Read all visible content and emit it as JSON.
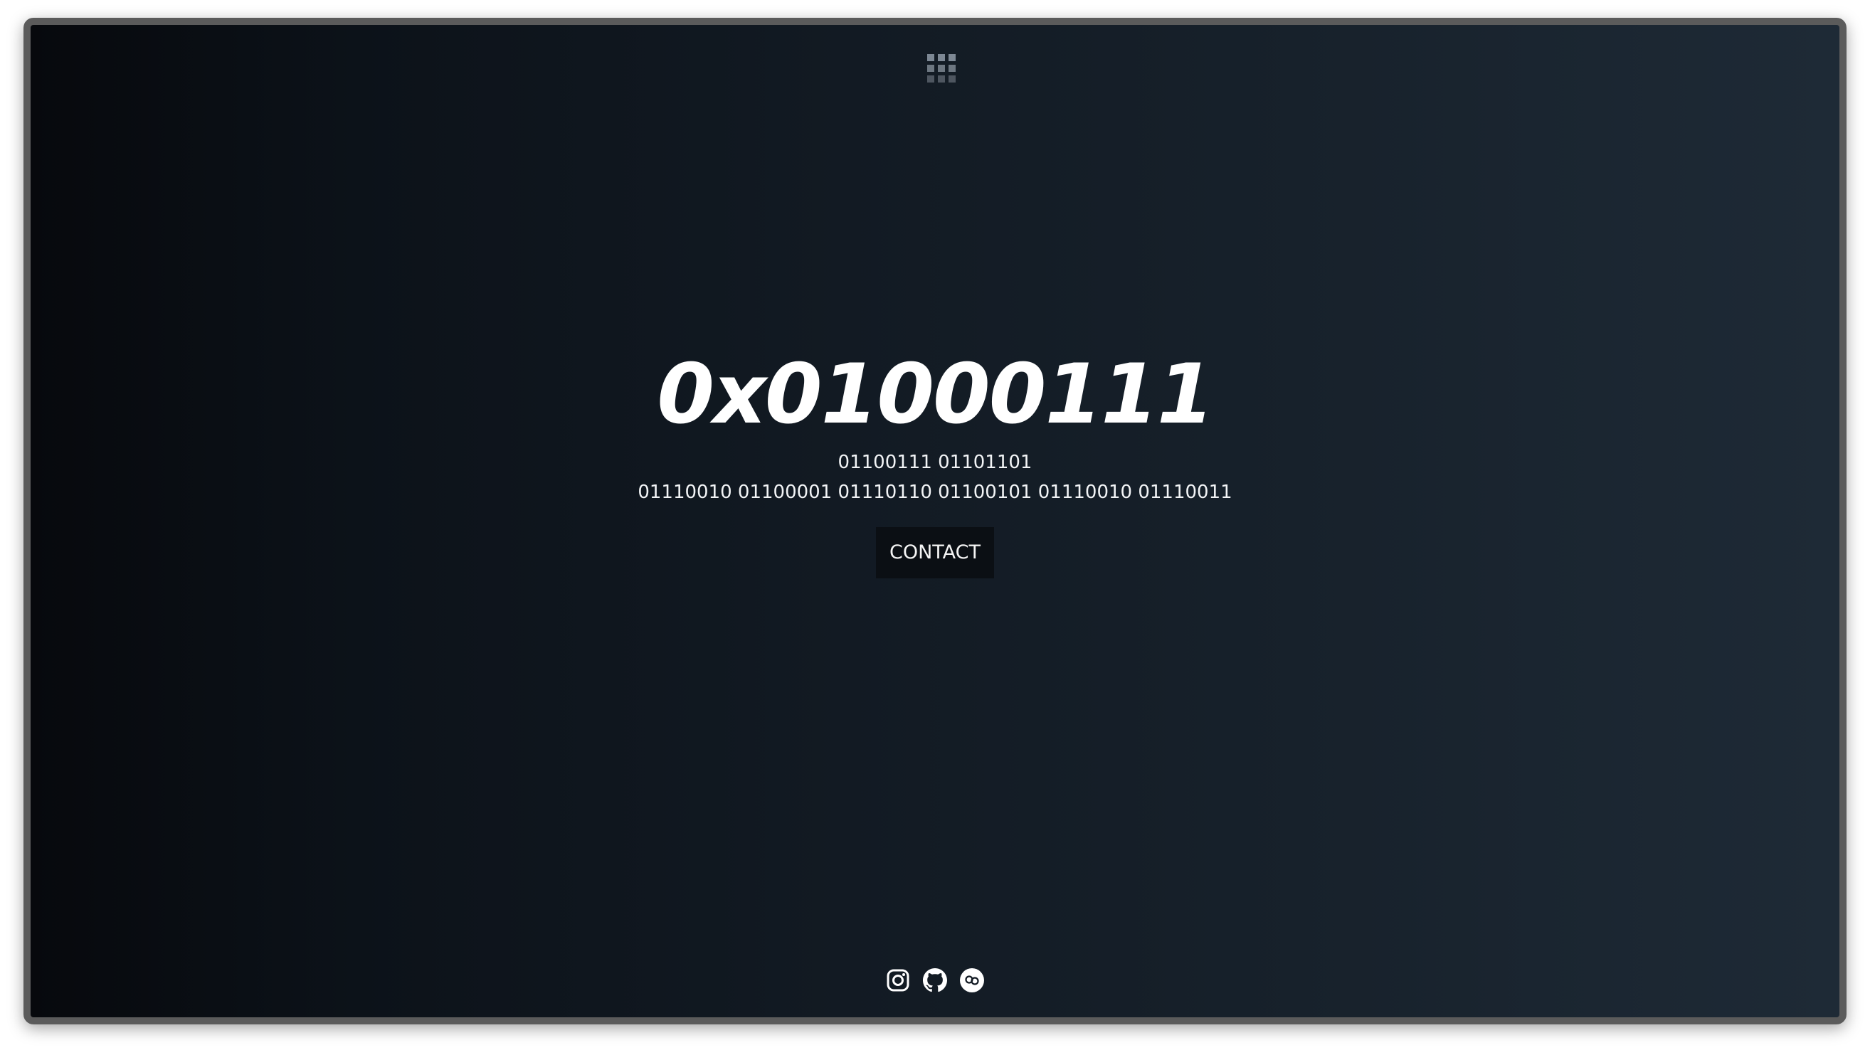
{
  "header": {
    "menu_icon": "grid-menu-icon"
  },
  "hero": {
    "title": "0x01000111",
    "binary_line_1": "01100111 01101101",
    "binary_line_2": "01110010 01100001 01110110 01100101 01110010 01110011",
    "contact_label": "CONTACT"
  },
  "social": {
    "icons": [
      "instagram-icon",
      "github-icon",
      "linktree-icon"
    ]
  },
  "colors": {
    "text": "#ffffff",
    "button_bg": "#0b0f14",
    "bg_left": "#07090d",
    "bg_right": "#1e2a36"
  }
}
